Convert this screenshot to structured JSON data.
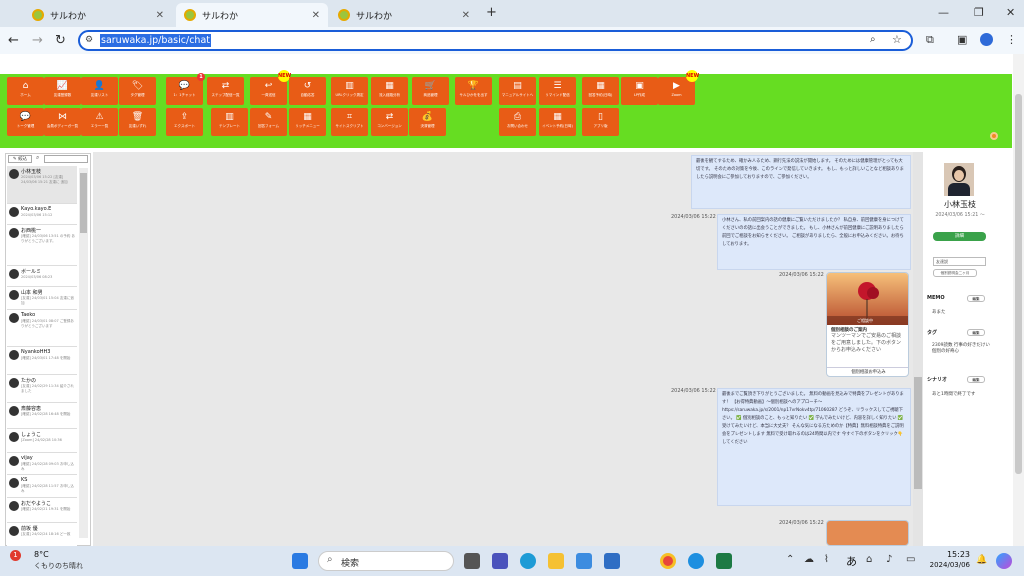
{
  "browser": {
    "tabs": [
      {
        "title": "サルわか"
      },
      {
        "title": "サルわか"
      },
      {
        "title": "サルわか"
      }
    ],
    "new_tab": "+",
    "url": "saruwaka.jp/basic/chat"
  },
  "toolbar": {
    "row1": [
      {
        "label": "ホーム",
        "icon": "home-icon",
        "glyph": "⌂"
      },
      {
        "label": "友達登録数",
        "icon": "chart-icon",
        "glyph": "📈"
      },
      {
        "label": "友達リスト",
        "icon": "person-icon",
        "glyph": "👤"
      },
      {
        "label": "タグ管理",
        "icon": "tag-icon",
        "glyph": "🏷"
      },
      {
        "label": "1：1チャット",
        "icon": "chat-icon",
        "glyph": "💬",
        "badge": "1"
      },
      {
        "label": "ステップ配信一覧",
        "icon": "shuffle-icon",
        "glyph": "⇄"
      },
      {
        "label": "一斉送信",
        "icon": "reply-icon",
        "glyph": "↩",
        "badge": "NEW"
      },
      {
        "label": "自動応答",
        "icon": "undo-icon",
        "glyph": "↺"
      },
      {
        "label": "URLクリック測定",
        "icon": "bar-chart-icon",
        "glyph": "▥"
      },
      {
        "label": "流入経路分析",
        "icon": "analytics-icon",
        "glyph": "▦"
      },
      {
        "label": "商品管理",
        "icon": "cart-icon",
        "glyph": "🛒"
      },
      {
        "label": "サルひかをを出す",
        "icon": "trophy-icon",
        "glyph": "🏆"
      },
      {
        "label": "マニュアルサイトへ",
        "icon": "document-icon",
        "glyph": "▤"
      },
      {
        "label": "リマインド配信",
        "icon": "list-icon",
        "glyph": "☰"
      },
      {
        "label": "回答予約(日時)",
        "icon": "calendar-grid-icon",
        "glyph": "▦"
      },
      {
        "label": "LP作成",
        "icon": "lp-icon",
        "glyph": "▣"
      },
      {
        "label": "Zoom",
        "icon": "zoom-icon",
        "glyph": "▶",
        "badge": "NEW"
      }
    ],
    "row2": [
      {
        "label": "トーク管理",
        "icon": "talk-icon",
        "glyph": "💬"
      },
      {
        "label": "会員ボディーガ一覧",
        "icon": "bowtie-icon",
        "glyph": "⋈"
      },
      {
        "label": "エラー一覧",
        "icon": "warning-icon",
        "glyph": "⚠"
      },
      {
        "label": "友達いずれ",
        "icon": "trash-icon",
        "glyph": "🗑"
      },
      {
        "label": "エクスポート",
        "icon": "export-icon",
        "glyph": "⇪"
      },
      {
        "label": "テンプレート",
        "icon": "columns-icon",
        "glyph": "▥"
      },
      {
        "label": "回答フォーム",
        "icon": "form-icon",
        "glyph": "✎"
      },
      {
        "label": "リッチメニュー",
        "icon": "grid-icon",
        "glyph": "▦"
      },
      {
        "label": "サイトスクリプト",
        "icon": "code-icon",
        "glyph": "⌗"
      },
      {
        "label": "コンバージョン",
        "icon": "exchange-icon",
        "glyph": "⇄"
      },
      {
        "label": "決済管理",
        "icon": "money-icon",
        "glyph": "💰"
      },
      {
        "label": "お問い合わせ",
        "icon": "print-icon",
        "glyph": "⎙"
      },
      {
        "label": "イベント予約(日時)",
        "icon": "calendar-icon",
        "glyph": "▦"
      },
      {
        "label": "アプリ版",
        "icon": "mobile-icon",
        "glyph": "▯"
      }
    ]
  },
  "list": {
    "search_label": "✎ 絞込",
    "items": [
      {
        "name": "小林玉枝",
        "time": "2024/03/06 15:22",
        "preview": "[友達] 24/03/06 15:21 友達に 追加"
      },
      {
        "name": "Kayo.kayo.E",
        "time": "2024/03/06 15:12",
        "preview": ""
      },
      {
        "name": "お西桃一",
        "time": "",
        "preview": "[確認] 24/03/06 13:51 の予約 ありがとうございます。"
      },
      {
        "name": "ボールミ",
        "time": "2024/03/06 08:23",
        "preview": ""
      },
      {
        "name": "山本 和男",
        "time": "",
        "preview": "[友達] 24/03/01 15:04 友達に追加"
      },
      {
        "name": "Taeko",
        "time": "",
        "preview": "[確認] 24/03/01 08:07 ご登録ありがとうございます"
      },
      {
        "name": "NyankoHH3",
        "time": "",
        "preview": "[確認] 24/03/01 17:48 を開始"
      },
      {
        "name": "たかの",
        "time": "",
        "preview": "[友達] 24/02/29 11:34 紹介されました"
      },
      {
        "name": "斎藤容恵",
        "time": "",
        "preview": "[確認] 24/02/28 16:48 を開始"
      },
      {
        "name": "しょうこ",
        "time": "",
        "preview": "[Zoom] 24/02/28 10:36"
      },
      {
        "name": "vijay",
        "time": "",
        "preview": "[確認] 24/02/28 09:03 お申し込み"
      },
      {
        "name": "KS",
        "time": "",
        "preview": "[確認] 24/02/28 11:57 お申し込み"
      },
      {
        "name": "おだやようこ",
        "time": "",
        "preview": "[確認] 24/02/21 19:31 を開始"
      },
      {
        "name": "前坂 優",
        "time": "",
        "preview": "[友達] 24/02/24 18:16 ど一致"
      }
    ]
  },
  "chat": {
    "messages": [
      {
        "time": "",
        "text": "最後を観てするため、確かみ人るため、鋼行先法の説法が開始します。 そのためには健康管理がとっても大切です。 そのための対策を今後、このラインで発信していきます。 もし、もっと詳しいことなど相談ありましたら説明会にご参加しておりますので、ご参加ください。"
      },
      {
        "time": "2024/03/06 15:22",
        "text": "小林さん、私の前回案内の話の健康にご覧いただけましたか？ 私自身、前回健康を身につけてくださいのの話に出会うことができました。 もし、小林さんが前回健康にご説明ありましたら前回でご相談をお知らせください。 ご相談がありましたら、全般にお申込みください。お待ちしております。"
      },
      {
        "time": "2024/03/06 15:22",
        "card_title": "個別相談のご案内",
        "card_text": "マンツーマンでご安易のご相談をご用意しました。下のボタンからお申込みください",
        "card_link": "個別相談お申込み",
        "card_caption": "ご相談中"
      },
      {
        "time": "2024/03/06 15:22",
        "text": "最後までご覧頂き下りがとうございました。 無料の動画を見込みで特典をプレゼントがあります！ 【お得特典動画】～個別相談へのアプローチ～ https://saruwaka.jp/s/2001/np17vrNokv4tp/71060287 どうぞ、リラックスしてご視聴下さい。 ✅ 個別相談のこと、もっと知りたい ✅ 学んでみたいけど、内容を詳しく知りたい ✅ 受けてみたいけど、本当に大丈夫？ そんな気になる方ためのか【特典】無料相談特典をご説明会をプレゼントします 無料で受け取れるのは24時間以内です 今すぐ下のボタンをクリック👇してください"
      },
      {
        "time": "2024/03/06 15:22",
        "text": ""
      }
    ]
  },
  "profile": {
    "name": "小林玉枝",
    "time": "2024/03/06 15:21 ～",
    "status_button": "詳細",
    "field_label": "友達説",
    "edit_button": "個別説明会二ヶ月",
    "memo_title": "MEMO",
    "memo_edit": "編集",
    "memo_text": "あまた",
    "tag_title": "タグ",
    "tag_edit": "編集",
    "tag_text": "2309読数 行事の好きだけい 個別の好奇心",
    "scenario_title": "シナリオ",
    "scenario_edit": "編集",
    "scenario_text": "あと1時間で終了です"
  },
  "taskbar": {
    "weather_temp": "8°C",
    "weather_desc": "くもりのち晴れ",
    "search_placeholder": "検索",
    "ime": "あ",
    "time": "15:23",
    "date": "2024/03/06"
  }
}
